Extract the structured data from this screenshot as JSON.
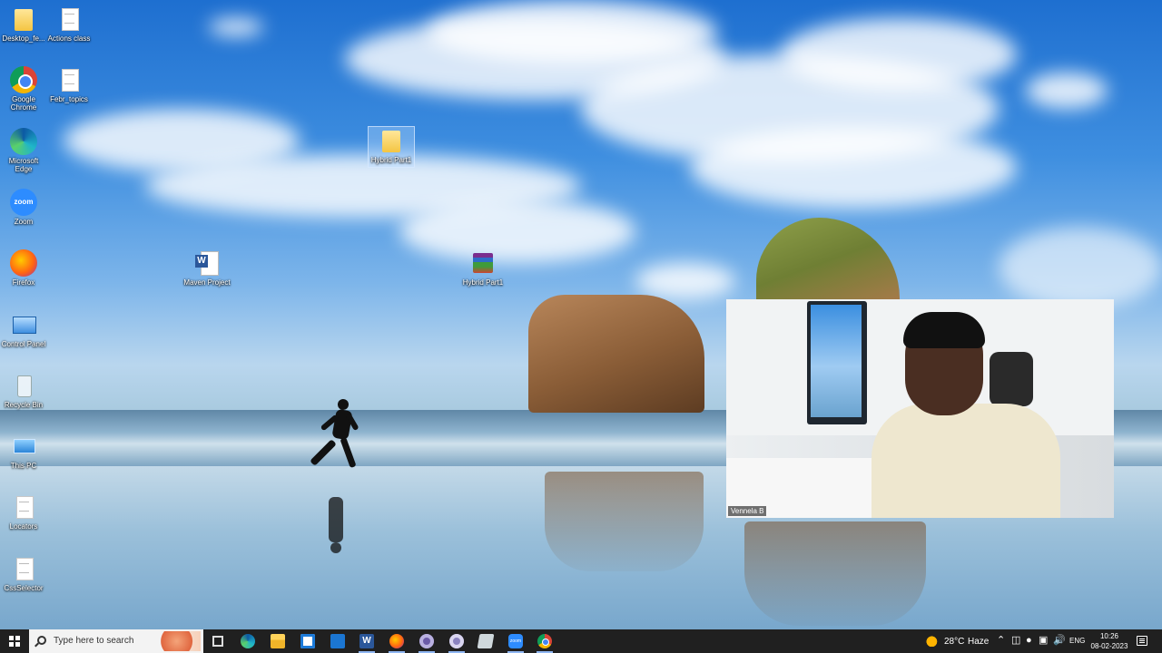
{
  "desktop": {
    "icons": [
      {
        "label": "Desktop_fe...",
        "icon": "folder-icon"
      },
      {
        "label": "Actions class",
        "icon": "document-icon"
      },
      {
        "label": "Google Chrome",
        "icon": "chrome-icon"
      },
      {
        "label": "Febr_topics",
        "icon": "document-icon"
      },
      {
        "label": "Microsoft Edge",
        "icon": "edge-icon"
      },
      {
        "label": "Zoom",
        "icon": "zoom-icon"
      },
      {
        "label": "Firefox",
        "icon": "firefox-icon"
      },
      {
        "label": "Control Panel",
        "icon": "control-panel-icon"
      },
      {
        "label": "Recycle Bin",
        "icon": "recycle-bin-icon"
      },
      {
        "label": "This PC",
        "icon": "this-pc-icon"
      },
      {
        "label": "Locators",
        "icon": "document-icon"
      },
      {
        "label": "CssSelector",
        "icon": "document-icon"
      },
      {
        "label": "Maven Project",
        "icon": "word-document-icon"
      },
      {
        "label": "Hybrid Part1",
        "icon": "folder-icon"
      },
      {
        "label": "Hybrid Part1",
        "icon": "winrar-archive-icon"
      }
    ]
  },
  "video": {
    "participant_name": "Vennela B"
  },
  "taskbar": {
    "search_placeholder": "Type here to search",
    "apps": [
      {
        "name": "task-view",
        "icon": "task-view-icon"
      },
      {
        "name": "edge",
        "icon": "edge-icon"
      },
      {
        "name": "file-explorer",
        "icon": "file-explorer-icon"
      },
      {
        "name": "store",
        "icon": "store-icon"
      },
      {
        "name": "mail",
        "icon": "mail-icon"
      },
      {
        "name": "word",
        "icon": "word-icon"
      },
      {
        "name": "firefox",
        "icon": "firefox-icon"
      },
      {
        "name": "app-1",
        "icon": "app-icon"
      },
      {
        "name": "app-2",
        "icon": "app-icon"
      },
      {
        "name": "notepad",
        "icon": "notepad-icon"
      },
      {
        "name": "zoom",
        "icon": "zoom-icon"
      },
      {
        "name": "chrome",
        "icon": "chrome-icon"
      }
    ],
    "word_glyph": "W",
    "zoom_glyph": "zoom",
    "weather": {
      "temp": "28°C",
      "desc": "Haze"
    },
    "language": "ENG",
    "clock": {
      "time": "10:26",
      "date": "08-02-2023"
    }
  },
  "colors": {
    "taskbar": "#202020",
    "sky": "#3f8fe0"
  }
}
